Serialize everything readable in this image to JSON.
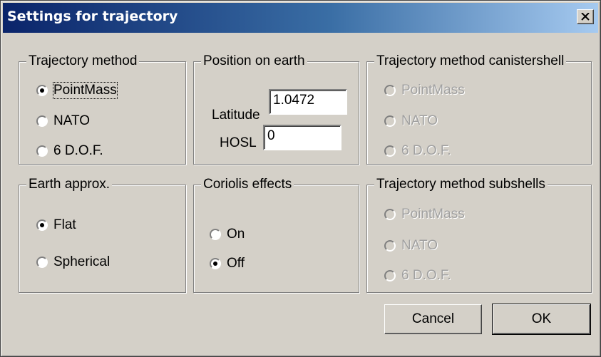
{
  "window": {
    "title": "Settings for trajectory"
  },
  "groups": {
    "trajectory_method": {
      "title": "Trajectory method",
      "options": [
        "PointMass",
        "NATO",
        "6 D.O.F."
      ],
      "selected": "PointMass"
    },
    "position": {
      "title": "Position on earth",
      "latitude_label": "Latitude",
      "latitude_value": "1.0472",
      "hosl_label": "HOSL",
      "hosl_value": "0"
    },
    "canistershell": {
      "title": "Trajectory method canistershell",
      "options": [
        "PointMass",
        "NATO",
        "6 D.O.F."
      ],
      "enabled": false
    },
    "earth_approx": {
      "title": "Earth approx.",
      "options": [
        "Flat",
        "Spherical"
      ],
      "selected": "Flat"
    },
    "coriolis": {
      "title": "Coriolis effects",
      "options": [
        "On",
        "Off"
      ],
      "selected": "Off"
    },
    "subshells": {
      "title": "Trajectory method subshells",
      "options": [
        "PointMass",
        "NATO",
        "6 D.O.F."
      ],
      "enabled": false
    }
  },
  "buttons": {
    "cancel": "Cancel",
    "ok": "OK"
  },
  "colors": {
    "face": "#d4d0c8",
    "title_start": "#0a246a",
    "title_end": "#a6caf0",
    "disabled_text": "#a0a0a0"
  }
}
